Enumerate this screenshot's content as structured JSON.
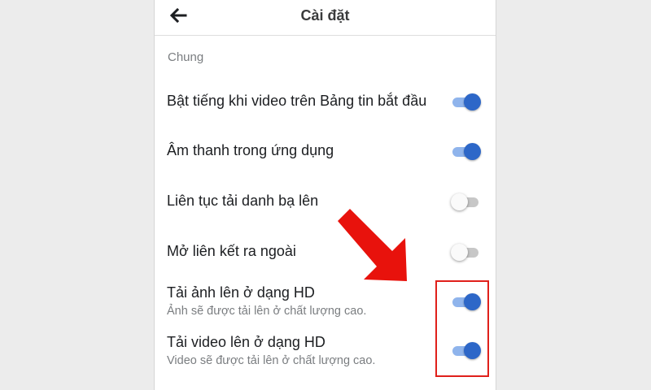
{
  "header": {
    "back_icon": "back-arrow-icon",
    "title": "Cài đặt"
  },
  "section": {
    "label": "Chung"
  },
  "settings": [
    {
      "label": "Bật tiếng khi video trên Bảng tin bắt đầu",
      "subtitle": "",
      "enabled": true
    },
    {
      "label": "Âm thanh trong ứng dụng",
      "subtitle": "",
      "enabled": true
    },
    {
      "label": "Liên tục tải danh bạ lên",
      "subtitle": "",
      "enabled": false
    },
    {
      "label": "Mở liên kết ra ngoài",
      "subtitle": "",
      "enabled": false
    },
    {
      "label": "Tải ảnh lên ở dạng HD",
      "subtitle": "Ảnh sẽ được tải lên ở chất lượng cao.",
      "enabled": true
    },
    {
      "label": "Tải video lên ở dạng HD",
      "subtitle": "Video sẽ được tải lên ở chất lượng cao.",
      "enabled": true
    }
  ],
  "annotation": {
    "arrow_icon": "red-arrow-icon",
    "arrow_color": "#e8120c",
    "box_color": "#e0201b"
  },
  "colors": {
    "toggle_on_knob": "#2d67c8",
    "toggle_on_track": "#8fb4ec",
    "toggle_off_track": "#c7c7c7"
  }
}
